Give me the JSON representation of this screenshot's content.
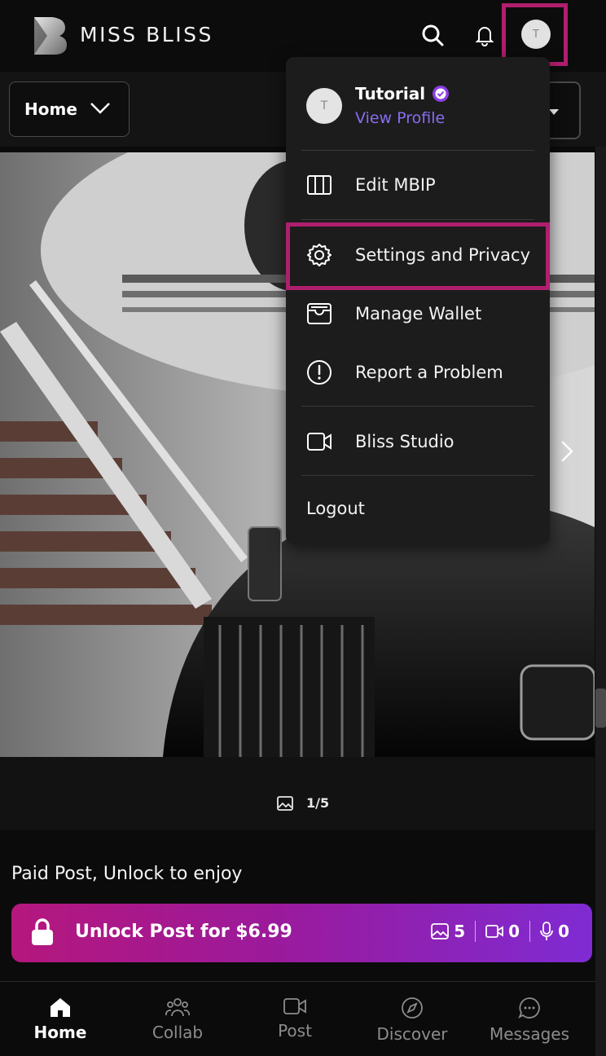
{
  "brand": {
    "name": "MISS BLISS"
  },
  "header": {
    "avatar_initial": "T"
  },
  "filter": {
    "selected": "Home"
  },
  "post": {
    "media_counter": "1/5",
    "paid_text": "Paid Post, Unlock to enjoy",
    "unlock_label": "Unlock Post for $6.99",
    "stats": {
      "images": "5",
      "videos": "0",
      "audio": "0"
    }
  },
  "menu": {
    "user_initial": "T",
    "user_name": "Tutorial",
    "view_profile": "View Profile",
    "items": [
      {
        "label": "Edit MBIP",
        "icon": "columns-icon"
      },
      {
        "label": "Settings and Privacy",
        "icon": "gear-icon"
      },
      {
        "label": "Manage Wallet",
        "icon": "wallet-icon"
      },
      {
        "label": "Report a Problem",
        "icon": "alert-circle-icon"
      },
      {
        "label": "Bliss Studio",
        "icon": "video-camera-icon"
      }
    ],
    "logout": "Logout"
  },
  "bottom_nav": [
    {
      "label": "Home",
      "icon": "home-icon",
      "active": true
    },
    {
      "label": "Collab",
      "icon": "users-icon"
    },
    {
      "label": "Post",
      "icon": "video-camera-icon"
    },
    {
      "label": "Discover",
      "icon": "compass-icon"
    },
    {
      "label": "Messages",
      "icon": "chat-icon"
    }
  ],
  "colors": {
    "accent_highlight": "#b01e6e",
    "link_purple": "#8a6cf0",
    "unlock_start": "#b5177d",
    "unlock_end": "#7f2bd3"
  }
}
